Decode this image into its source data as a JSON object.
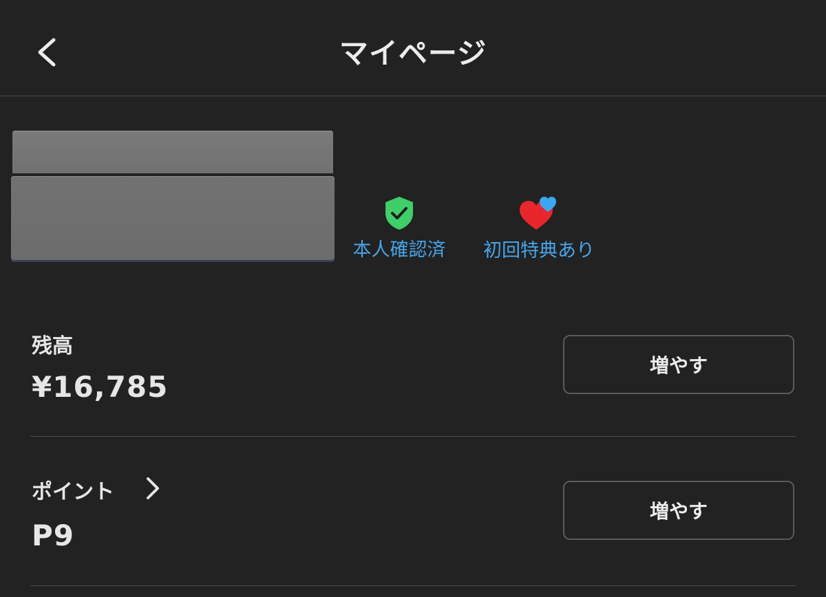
{
  "header": {
    "title": "マイページ",
    "back_icon": "chevron-left-icon"
  },
  "profile": {
    "badges": [
      {
        "label": "本人確認済",
        "icon": "shield-check-icon",
        "color": "#46a5ea",
        "icon_color": "#3ecf6a"
      },
      {
        "label": "初回特典あり",
        "icon": "hearts-icon",
        "color": "#46a5ea",
        "icon_color": "#e8262c"
      }
    ]
  },
  "balance": {
    "label": "残高",
    "value": "¥16,785",
    "button_label": "増やす"
  },
  "points": {
    "label": "ポイント",
    "value": "P9",
    "button_label": "増やす",
    "chevron_icon": "chevron-right-icon"
  },
  "colors": {
    "background": "#222222",
    "divider": "#4a4a4a",
    "accent": "#46a5ea"
  }
}
